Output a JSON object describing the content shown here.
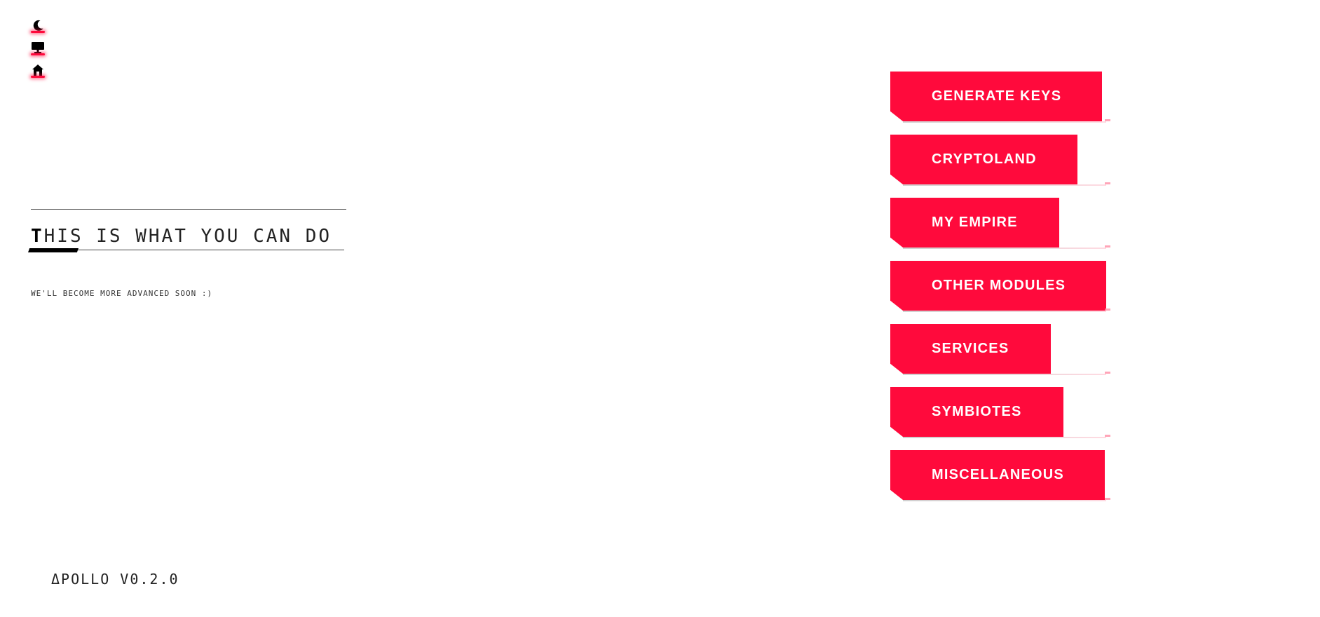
{
  "rail": {
    "icons": [
      {
        "name": "moon-icon"
      },
      {
        "name": "monitor-icon"
      },
      {
        "name": "home-icon"
      }
    ]
  },
  "heading": {
    "title_first": "T",
    "title_rest": "HIS IS WHAT YOU CAN DO",
    "subtitle": "WE'LL BECOME MORE ADVANCED SOON :)"
  },
  "menu": {
    "items": [
      {
        "label": "GENERATE KEYS"
      },
      {
        "label": "CRYPTOLAND"
      },
      {
        "label": "MY EMPIRE"
      },
      {
        "label": "OTHER MODULES"
      },
      {
        "label": "SERVICES"
      },
      {
        "label": "SYMBIOTES"
      },
      {
        "label": "MISCELLANEOUS"
      }
    ]
  },
  "footer": {
    "version": "ΔPOLLO V0.2.0"
  },
  "colors": {
    "accent": "#ff0a3c",
    "text": "#222222",
    "background": "#ffffff"
  }
}
